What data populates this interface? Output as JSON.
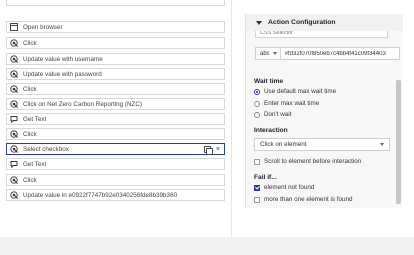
{
  "steps": [
    {
      "icon": "browser-window-icon",
      "label": "Open browser"
    },
    {
      "icon": "click-target-icon",
      "label": "Click"
    },
    {
      "icon": "click-target-icon",
      "label": "Update value with username"
    },
    {
      "icon": "click-target-icon",
      "label": "Update value with password"
    },
    {
      "icon": "click-target-icon",
      "label": "Click"
    },
    {
      "icon": "click-target-icon",
      "label": "Click on Net Zero Carbon Reporting (NZC)"
    },
    {
      "icon": "get-text-icon",
      "label": "Get Text"
    },
    {
      "icon": "click-target-icon",
      "label": "Click"
    },
    {
      "icon": "click-target-icon",
      "label": "Select checkbox",
      "selected": true
    },
    {
      "icon": "get-text-icon",
      "label": "Get Text"
    },
    {
      "icon": "click-target-icon",
      "label": "Click"
    },
    {
      "icon": "click-target-icon",
      "label": "Update value in e0922f7747b92e0340256fde8b39b360"
    }
  ],
  "step_actions": {
    "copy_icon": "copy-icon",
    "delete_symbol": "×"
  },
  "panel": {
    "title": "Action Configuration",
    "selector_type_remnant": "CSS Selector",
    "value_type": "abc",
    "value": "#fd32f070f850eb7c4bb4f41c09f34403",
    "wait_time": {
      "title": "Wait time",
      "options": [
        "Use default max wait time",
        "Enter max wait time",
        "Don't wait"
      ],
      "selected_index": 0
    },
    "interaction": {
      "title": "Interaction",
      "selected": "Click on element",
      "scroll_label": "Scroll to element before interaction",
      "scroll_checked": false
    },
    "fail_if": {
      "title": "Fail if...",
      "options": [
        {
          "label": "element not found",
          "checked": true
        },
        {
          "label": "more than one element is found",
          "checked": false
        }
      ]
    }
  },
  "colors": {
    "accent": "#2f3a9c",
    "panel_bg": "#f7f7f7",
    "border": "#d8d8d8"
  }
}
